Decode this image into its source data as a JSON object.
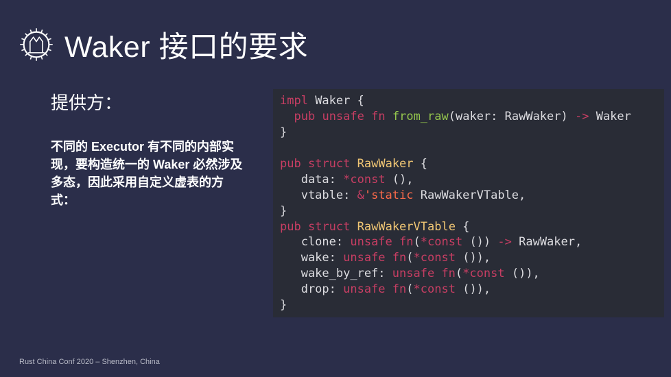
{
  "header": {
    "title": "Waker 接口的要求"
  },
  "left": {
    "subheading": "提供方：",
    "body": "不同的 Executor 有不同的内部实现，要构造统一的 Waker 必然涉及多态，因此采用自定义虚表的方式："
  },
  "code": {
    "tokens": [
      {
        "t": "impl",
        "c": "kw"
      },
      {
        "t": " Waker {\n"
      },
      {
        "t": "  "
      },
      {
        "t": "pub",
        "c": "kw"
      },
      {
        "t": " "
      },
      {
        "t": "unsafe",
        "c": "kw"
      },
      {
        "t": " "
      },
      {
        "t": "fn",
        "c": "kw"
      },
      {
        "t": " "
      },
      {
        "t": "from_raw",
        "c": "fn"
      },
      {
        "t": "(waker: RawWaker) "
      },
      {
        "t": "->",
        "c": "op"
      },
      {
        "t": " Waker\n"
      },
      {
        "t": "}\n"
      },
      {
        "t": "\n"
      },
      {
        "t": "pub",
        "c": "kw"
      },
      {
        "t": " "
      },
      {
        "t": "struct",
        "c": "kw"
      },
      {
        "t": " "
      },
      {
        "t": "RawWaker",
        "c": "ty"
      },
      {
        "t": " {\n"
      },
      {
        "t": "   data: "
      },
      {
        "t": "*",
        "c": "op"
      },
      {
        "t": "const",
        "c": "kw"
      },
      {
        "t": " (),\n"
      },
      {
        "t": "   vtable: "
      },
      {
        "t": "&",
        "c": "op"
      },
      {
        "t": "'static",
        "c": "lt"
      },
      {
        "t": " RawWakerVTable,\n"
      },
      {
        "t": "}\n"
      },
      {
        "t": "pub",
        "c": "kw"
      },
      {
        "t": " "
      },
      {
        "t": "struct",
        "c": "kw"
      },
      {
        "t": " "
      },
      {
        "t": "RawWakerVTable",
        "c": "ty"
      },
      {
        "t": " {\n"
      },
      {
        "t": "   clone: "
      },
      {
        "t": "unsafe",
        "c": "kw"
      },
      {
        "t": " "
      },
      {
        "t": "fn",
        "c": "kw"
      },
      {
        "t": "("
      },
      {
        "t": "*",
        "c": "op"
      },
      {
        "t": "const",
        "c": "kw"
      },
      {
        "t": " ()) "
      },
      {
        "t": "->",
        "c": "op"
      },
      {
        "t": " RawWaker,\n"
      },
      {
        "t": "   wake: "
      },
      {
        "t": "unsafe",
        "c": "kw"
      },
      {
        "t": " "
      },
      {
        "t": "fn",
        "c": "kw"
      },
      {
        "t": "("
      },
      {
        "t": "*",
        "c": "op"
      },
      {
        "t": "const",
        "c": "kw"
      },
      {
        "t": " ()),\n"
      },
      {
        "t": "   wake_by_ref: "
      },
      {
        "t": "unsafe",
        "c": "kw"
      },
      {
        "t": " "
      },
      {
        "t": "fn",
        "c": "kw"
      },
      {
        "t": "("
      },
      {
        "t": "*",
        "c": "op"
      },
      {
        "t": "const",
        "c": "kw"
      },
      {
        "t": " ()),\n"
      },
      {
        "t": "   drop: "
      },
      {
        "t": "unsafe",
        "c": "kw"
      },
      {
        "t": " "
      },
      {
        "t": "fn",
        "c": "kw"
      },
      {
        "t": "("
      },
      {
        "t": "*",
        "c": "op"
      },
      {
        "t": "const",
        "c": "kw"
      },
      {
        "t": " ()),\n"
      },
      {
        "t": "}"
      }
    ]
  },
  "footer": {
    "text": "Rust China Conf 2020 – Shenzhen, China"
  }
}
